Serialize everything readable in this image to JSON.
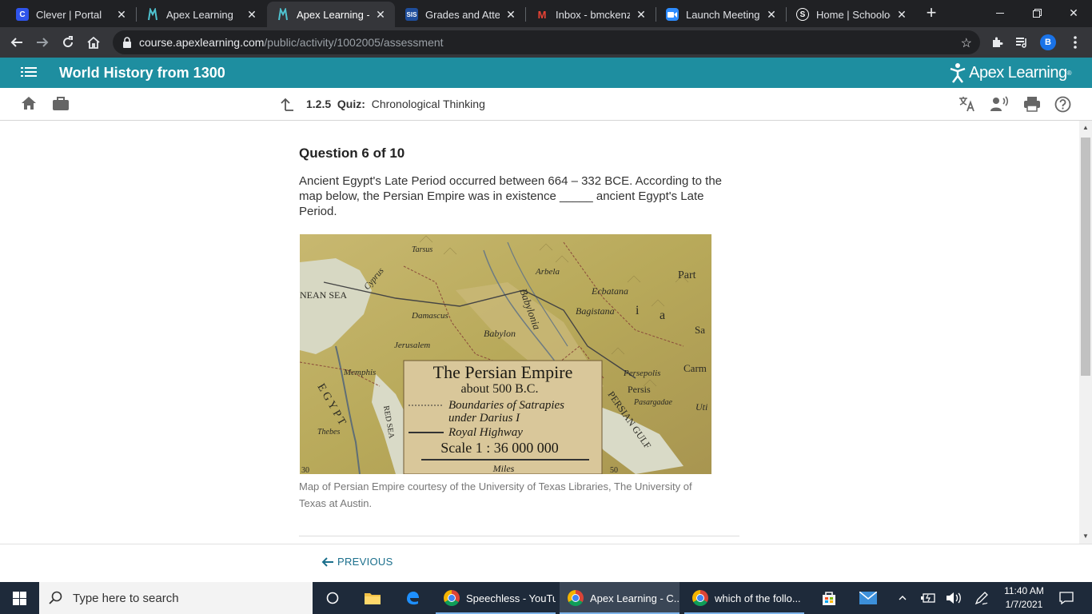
{
  "browser": {
    "tabs": [
      {
        "title": "Clever | Portal",
        "favicon": "C",
        "favicon_color": "#2f54eb"
      },
      {
        "title": "Apex Learning",
        "favicon": "",
        "favicon_color": "#1e8ea0"
      },
      {
        "title": "Apex Learning - Co",
        "favicon": "",
        "favicon_color": "#1e8ea0",
        "active": true
      },
      {
        "title": "Grades and Attenc",
        "favicon": "SIS",
        "favicon_color": "#1f4e9c"
      },
      {
        "title": "Inbox - bmckenzie",
        "favicon": "M",
        "favicon_color": "#ea4335"
      },
      {
        "title": "Launch Meeting - ",
        "favicon": "",
        "favicon_color": "#2d8cff"
      },
      {
        "title": "Home | Schoology",
        "favicon": "S",
        "favicon_color": "#ffffff"
      }
    ],
    "url_host": "course.apexlearning.com",
    "url_path": "/public/activity/1002005/assessment",
    "profile_initial": "B"
  },
  "apex": {
    "course_title": "World History from 1300",
    "logo_text": "Apex Learning",
    "brand_color": "#1e8ea0"
  },
  "activity": {
    "number": "1.2.5",
    "type": "Quiz:",
    "name": "Chronological Thinking"
  },
  "question": {
    "header": "Question 6 of 10",
    "text": "Ancient Egypt's Late Period occurred between 664 – 332 BCE. According to the map below, the Persian Empire was in existence _____ ancient Egypt's Late Period.",
    "map": {
      "title": "The Persian Empire",
      "subtitle": "about 500 B.C.",
      "legend_satrapies": "Boundaries of Satrapies",
      "legend_satrapies2": "under Darius I",
      "legend_highway": "Royal Highway",
      "scale": "Scale 1 : 36 000 000",
      "miles": "Miles",
      "labels": {
        "sea": "NEAN SEA",
        "cyprus": "Cyprus",
        "tarsus": "Tarsus",
        "damascus": "Damascus",
        "jerusalem": "Jerusalem",
        "memphis": "Memphis",
        "thebes": "Thebes",
        "babylon": "Babylon",
        "arbela": "Arbela",
        "ecbatana": "Ecbatana",
        "bagistana": "Bagistana",
        "persepolis": "Persepolis",
        "pasargadae": "Pasargadae",
        "persis": "Persis",
        "persian_gulf": "PERSIAN GULF",
        "red_sea": "RED SEA",
        "part": "Part",
        "egypt": "E G Y P T",
        "babylonia": "Babylonia",
        "sa": "Sa",
        "carm": "Carm",
        "uti": "Uti",
        "media_i": "i",
        "media_a": "a",
        "n30": "30",
        "n50": "50"
      }
    },
    "caption": "Map of Persian Empire courtesy of the University of Texas Libraries, The University of Texas at Austin."
  },
  "footer": {
    "previous_label": "PREVIOUS"
  },
  "taskbar": {
    "search_placeholder": "Type here to search",
    "apps": [
      {
        "label": "Speechless - YouTu..."
      },
      {
        "label": "Apex Learning - C...",
        "active": true
      },
      {
        "label": "which of the follo..."
      }
    ],
    "time": "11:40 AM",
    "date": "1/7/2021"
  }
}
